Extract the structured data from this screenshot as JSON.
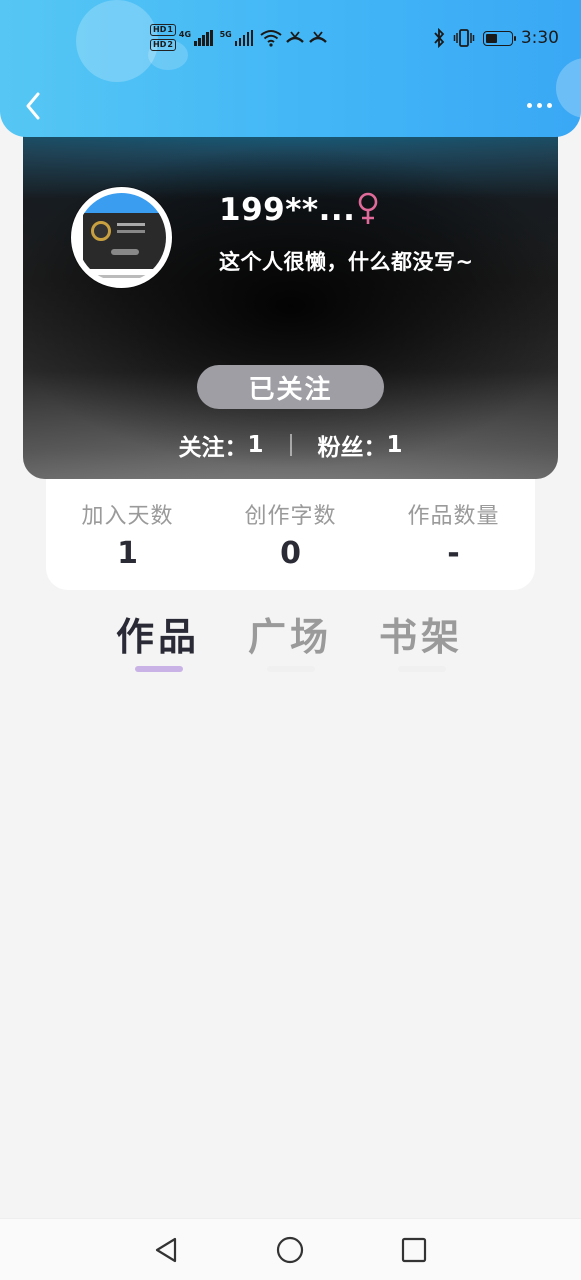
{
  "status_bar": {
    "hd1": "HD",
    "hd1_sub": "1",
    "hd2": "HD",
    "hd2_sub": "2",
    "net1": "4G",
    "net2": "5G",
    "time": "3:30",
    "battery_level": 0.45
  },
  "header": {
    "back_icon": "chevron-left-icon",
    "more_icon": "more-horizontal-icon"
  },
  "profile": {
    "nickname": "199**...",
    "gender": "female",
    "gender_color": "#e06a9a",
    "bio": "这个人很懒，什么都没写~",
    "follow_button_label": "已关注",
    "following_label": "关注：",
    "following_count": "1",
    "followers_label": "粉丝：",
    "followers_count": "1"
  },
  "stats": [
    {
      "label": "加入天数",
      "value": "1"
    },
    {
      "label": "创作字数",
      "value": "0"
    },
    {
      "label": "作品数量",
      "value": "-"
    }
  ],
  "tabs": [
    {
      "label": "作品",
      "active": true
    },
    {
      "label": "广场",
      "active": false
    },
    {
      "label": "书架",
      "active": false
    }
  ],
  "nav_bar": {
    "back_icon": "triangle-back-icon",
    "home_icon": "circle-home-icon",
    "recents_icon": "square-recents-icon"
  },
  "colors": {
    "header_blue": "#42b6f6",
    "tab_indicator": "#c9b2e6",
    "follow_button": "#9e9ea4"
  }
}
